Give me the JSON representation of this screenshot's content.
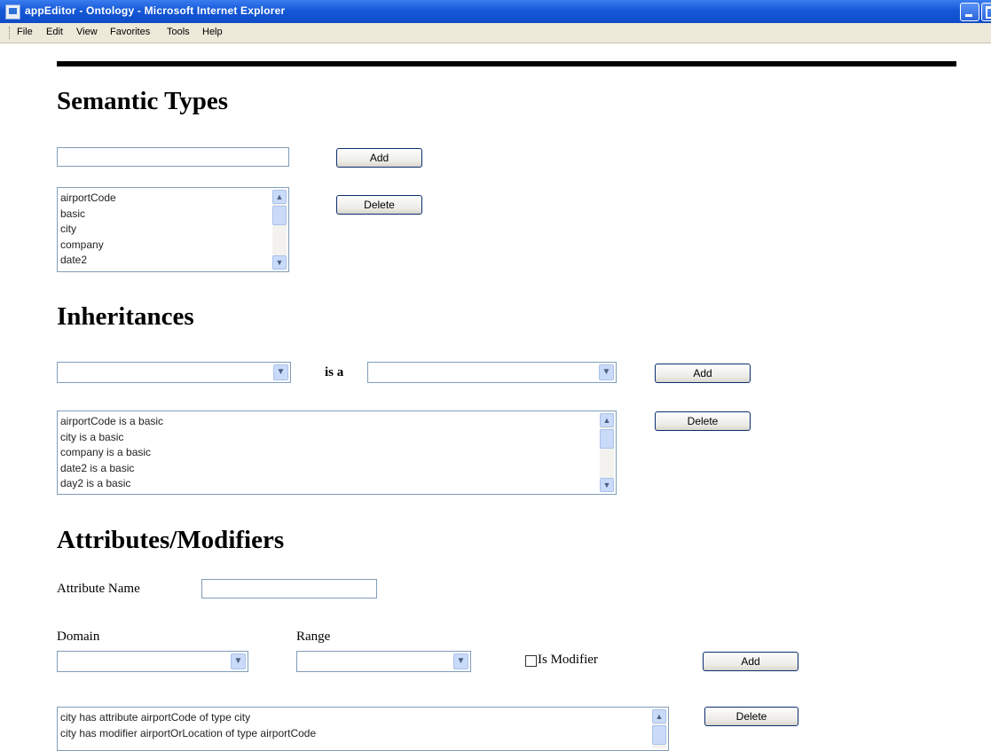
{
  "window": {
    "title": "appEditor - Ontology - Microsoft Internet Explorer"
  },
  "menu": [
    "File",
    "Edit",
    "View",
    "Favorites",
    "Tools",
    "Help"
  ],
  "semantic_types": {
    "heading": "Semantic Types",
    "input_value": "",
    "add_label": "Add",
    "delete_label": "Delete",
    "items": [
      "airportCode",
      "basic",
      "city",
      "company",
      "date2"
    ]
  },
  "inheritances": {
    "heading": "Inheritances",
    "left_value": "",
    "is_a_label": "is a",
    "right_value": "",
    "add_label": "Add",
    "delete_label": "Delete",
    "items": [
      "airportCode is a basic",
      "city is a basic",
      "company is a basic",
      "date2 is a basic",
      "day2 is a basic"
    ]
  },
  "attributes": {
    "heading": "Attributes/Modifiers",
    "attr_name_label": "Attribute Name",
    "attr_name_value": "",
    "domain_label": "Domain",
    "range_label": "Range",
    "domain_value": "",
    "range_value": "",
    "is_modifier_label": "Is Modifier",
    "is_modifier_checked": false,
    "add_label": "Add",
    "delete_label": "Delete",
    "items": [
      "city has attribute airportCode of type city",
      "city has modifier airportOrLocation of type airportCode"
    ]
  }
}
